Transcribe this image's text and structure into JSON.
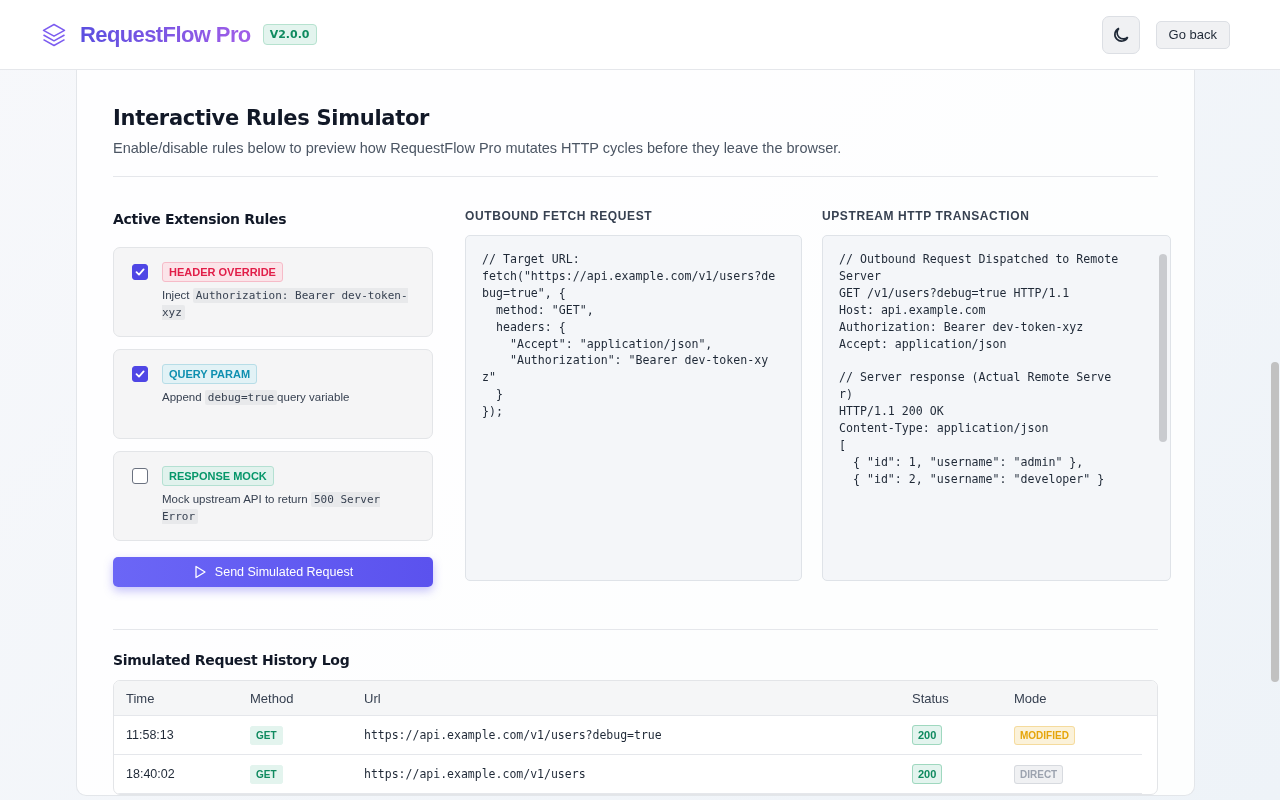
{
  "header": {
    "app_name": "RequestFlow Pro",
    "version": "V2.0.0",
    "back_button": "Go back"
  },
  "simulator": {
    "title": "Interactive Rules Simulator",
    "subtitle": "Enable/disable rules below to preview how RequestFlow Pro mutates HTTP cycles before they leave the browser.",
    "rules_heading": "Active Extension Rules",
    "rules": [
      {
        "checked": true,
        "tag": "HEADER OVERRIDE",
        "color": "#e11d48",
        "text_before": "Inject",
        "code": "Authorization: Bearer dev-token-xyz"
      },
      {
        "checked": true,
        "tag": "QUERY PARAM",
        "color": "#0e8fb0",
        "text_before": "Append",
        "code": "debug=true",
        "text_after": "query variable"
      },
      {
        "checked": false,
        "tag": "RESPONSE MOCK",
        "color": "#059669",
        "text_before": "Mock upstream API to return",
        "code": "500 Server Error"
      }
    ],
    "send_button": "Send Simulated Request",
    "outbound": {
      "heading": "OUTBOUND FETCH REQUEST",
      "code": "// Target URL:\nfetch(\"https://api.example.com/v1/users?de\nbug=true\", {\n  method: \"GET\",\n  headers: {\n    \"Accept\": \"application/json\",\n    \"Authorization\": \"Bearer dev-token-xy\nz\"\n  }\n});"
    },
    "upstream": {
      "heading": "UPSTREAM HTTP TRANSACTION",
      "code": "// Outbound Request Dispatched to Remote\nServer\nGET /v1/users?debug=true HTTP/1.1\nHost: api.example.com\nAuthorization: Bearer dev-token-xyz\nAccept: application/json\n\n// Server response (Actual Remote Serve\nr)\nHTTP/1.1 200 OK\nContent-Type: application/json\n[\n  { \"id\": 1, \"username\": \"admin\" },\n  { \"id\": 2, \"username\": \"developer\" }"
    }
  },
  "history": {
    "title": "Simulated Request History Log",
    "columns": [
      "Time",
      "Method",
      "Url",
      "Status",
      "Mode"
    ],
    "rows": [
      {
        "time": "11:58:13",
        "method": "GET",
        "url": "https://api.example.com/v1/users?debug=true",
        "status": "200",
        "mode": "MODIFIED",
        "color": "#e5a50a"
      },
      {
        "time": "18:40:02",
        "method": "GET",
        "url": "https://api.example.com/v1/users",
        "status": "200",
        "mode": "DIRECT",
        "color": "#9ca3af"
      }
    ]
  }
}
